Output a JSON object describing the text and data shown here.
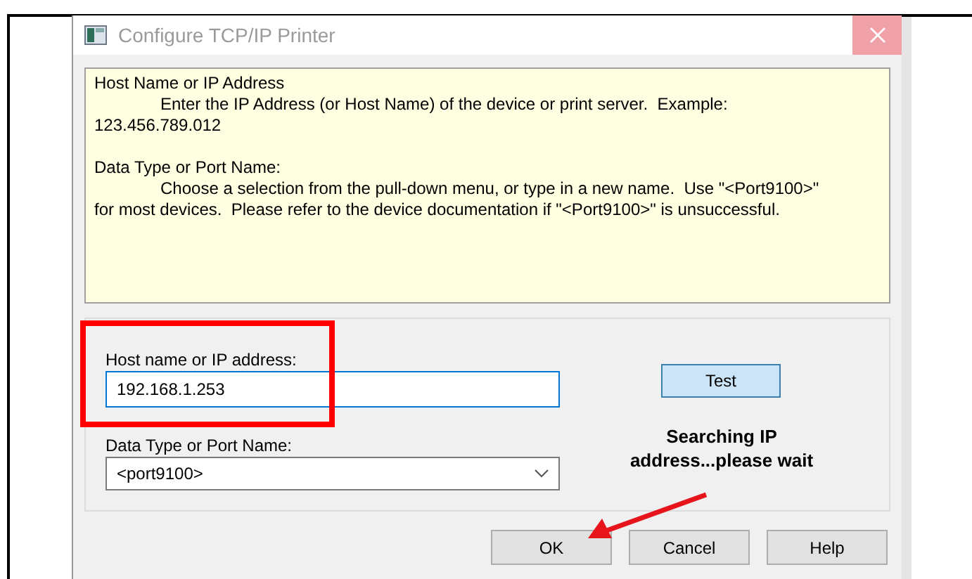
{
  "window": {
    "title": "Configure TCP/IP Printer"
  },
  "info": [
    {
      "heading": "Host Name or IP Address",
      "body_lines": [
        "Enter the IP Address (or Host Name) of the device or print server.  Example:",
        "123.456.789.012"
      ]
    },
    {
      "heading": "Data Type or Port Name:",
      "body_lines": [
        "Choose a selection from the pull-down menu, or type in a new name.  Use \"<Port9100>\"",
        "for most devices.  Please refer to the device documentation if \"<Port9100>\" is unsuccessful."
      ]
    }
  ],
  "host": {
    "label": "Host name or IP address:",
    "value": "192.168.1.253",
    "focused": true
  },
  "port": {
    "label": "Data Type or Port Name:",
    "value": "<port9100>"
  },
  "test_button": "Test",
  "status": [
    "Searching IP",
    "address...please wait"
  ],
  "buttons": [
    {
      "label": "OK"
    },
    {
      "label": "Cancel"
    },
    {
      "label": "Help"
    }
  ]
}
